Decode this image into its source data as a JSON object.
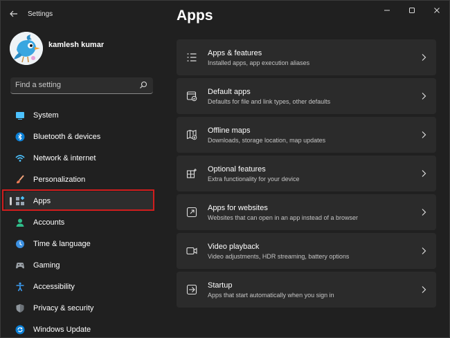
{
  "window": {
    "title": "Settings"
  },
  "user": {
    "name": "kamlesh kumar"
  },
  "search": {
    "placeholder": "Find a setting"
  },
  "sidebar": {
    "items": [
      {
        "label": "System",
        "icon": "system-icon"
      },
      {
        "label": "Bluetooth & devices",
        "icon": "bluetooth-icon"
      },
      {
        "label": "Network & internet",
        "icon": "wifi-icon"
      },
      {
        "label": "Personalization",
        "icon": "paintbrush-icon"
      },
      {
        "label": "Apps",
        "icon": "apps-icon",
        "selected": true
      },
      {
        "label": "Accounts",
        "icon": "accounts-icon"
      },
      {
        "label": "Time & language",
        "icon": "globe-clock-icon"
      },
      {
        "label": "Gaming",
        "icon": "gamepad-icon"
      },
      {
        "label": "Accessibility",
        "icon": "accessibility-icon"
      },
      {
        "label": "Privacy & security",
        "icon": "shield-icon"
      },
      {
        "label": "Windows Update",
        "icon": "update-icon"
      }
    ]
  },
  "main": {
    "title": "Apps",
    "cards": [
      {
        "title": "Apps & features",
        "subtitle": "Installed apps, app execution aliases",
        "icon": "list-icon"
      },
      {
        "title": "Default apps",
        "subtitle": "Defaults for file and link types, other defaults",
        "icon": "default-apps-icon"
      },
      {
        "title": "Offline maps",
        "subtitle": "Downloads, storage location, map updates",
        "icon": "map-icon"
      },
      {
        "title": "Optional features",
        "subtitle": "Extra functionality for your device",
        "icon": "optional-features-icon"
      },
      {
        "title": "Apps for websites",
        "subtitle": "Websites that can open in an app instead of a browser",
        "icon": "open-external-icon"
      },
      {
        "title": "Video playback",
        "subtitle": "Video adjustments, HDR streaming, battery options",
        "icon": "video-icon"
      },
      {
        "title": "Startup",
        "subtitle": "Apps that start automatically when you sign in",
        "icon": "startup-icon"
      }
    ]
  },
  "colors": {
    "background": "#202020",
    "card": "#2b2b2b",
    "selected_item": "#2d2d2d",
    "highlight_border": "#d11d1d",
    "accent": "#4cc2ff"
  }
}
